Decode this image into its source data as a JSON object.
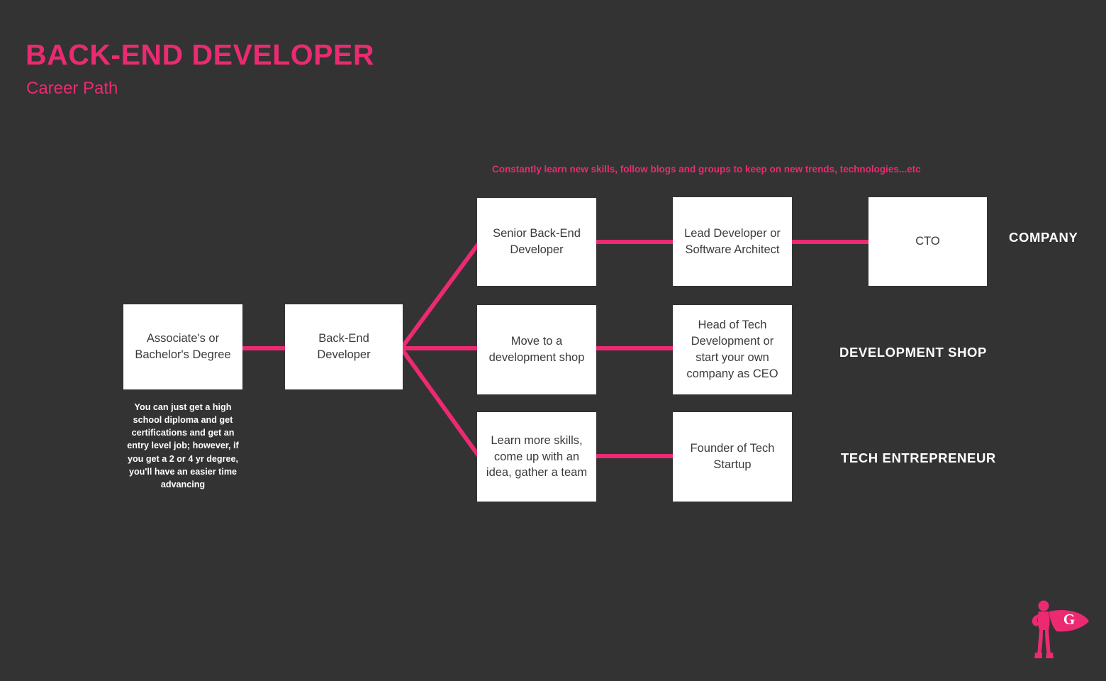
{
  "header": {
    "title": "BACK-END DEVELOPER",
    "subtitle": "Career Path"
  },
  "annotations": {
    "top_note": "Constantly learn new skills, follow blogs and groups to keep on new trends, technologies...etc",
    "degree_note": "You can just  get a high school diploma and get certifications and get an entry level job; however, if you get a 2 or 4 yr degree, you'll have an easier time advancing"
  },
  "nodes": {
    "start": "Associate's or Bachelor's Degree",
    "role": "Back-End Developer",
    "company_1": "Senior Back-End Developer",
    "company_2": "Lead Developer or Software Architect",
    "company_3": "CTO",
    "devshop_1": "Move to a development shop",
    "devshop_2": "Head of Tech Development or start your own company as CEO",
    "startup_1": "Learn more skills, come up with an idea, gather a team",
    "startup_2": "Founder of Tech Startup"
  },
  "track_labels": {
    "company": "COMPANY",
    "development_shop": "DEVELOPMENT SHOP",
    "tech_entrepreneur": "TECH ENTREPRENEUR"
  },
  "logo": {
    "letter": "G",
    "name": "superhero-logo"
  },
  "colors": {
    "background": "#333333",
    "accent_pink": "#EB2A72",
    "node_fill": "#FFFFFF",
    "node_text": "#3b3b3b",
    "label_text": "#FFFFFF"
  },
  "chart_data": {
    "type": "diagram",
    "title": "BACK-END DEVELOPER Career Path",
    "layout": "left-to-right branching flow with 3 parallel tracks",
    "tracks": [
      {
        "name": "COMPANY",
        "steps": [
          "Senior Back-End Developer",
          "Lead Developer or Software Architect",
          "CTO"
        ]
      },
      {
        "name": "DEVELOPMENT SHOP",
        "steps": [
          "Move to a development shop",
          "Head of Tech Development or start your own company as CEO"
        ]
      },
      {
        "name": "TECH ENTREPRENEUR",
        "steps": [
          "Learn more skills, come up with an idea, gather a team",
          "Founder of Tech Startup"
        ]
      }
    ],
    "shared_steps": [
      "Associate's or Bachelor's Degree",
      "Back-End Developer"
    ],
    "edges": [
      {
        "from": "Associate's or Bachelor's Degree",
        "to": "Back-End Developer",
        "style": "straight"
      },
      {
        "from": "Back-End Developer",
        "to": "Senior Back-End Developer",
        "style": "diagonal-up"
      },
      {
        "from": "Back-End Developer",
        "to": "Move to a development shop",
        "style": "straight"
      },
      {
        "from": "Back-End Developer",
        "to": "Learn more skills, come up with an idea, gather a team",
        "style": "diagonal-down"
      },
      {
        "from": "Senior Back-End Developer",
        "to": "Lead Developer or Software Architect",
        "style": "straight"
      },
      {
        "from": "Lead Developer or Software Architect",
        "to": "CTO",
        "style": "straight"
      },
      {
        "from": "Move to a development shop",
        "to": "Head of Tech Development or start your own company as CEO",
        "style": "straight"
      },
      {
        "from": "Learn more skills, come up with an idea, gather a team",
        "to": "Founder of Tech Startup",
        "style": "straight"
      }
    ]
  }
}
